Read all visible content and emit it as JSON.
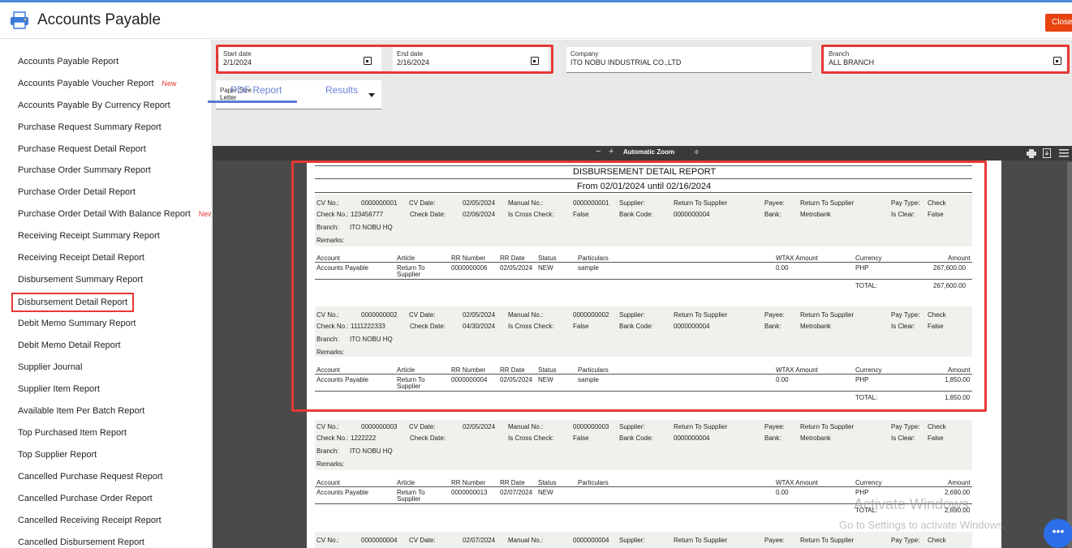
{
  "header": {
    "title": "Accounts Payable",
    "close_label": "Close"
  },
  "sidebar": {
    "items": [
      {
        "label": "Accounts Payable Report",
        "badge": ""
      },
      {
        "label": "Accounts Payable Voucher Report",
        "badge": "New"
      },
      {
        "label": "Accounts Payable By Currency Report",
        "badge": ""
      },
      {
        "label": "Purchase Request Summary Report",
        "badge": ""
      },
      {
        "label": "Purchase Request Detail Report",
        "badge": ""
      },
      {
        "label": "Purchase Order Summary Report",
        "badge": ""
      },
      {
        "label": "Purchase Order Detail Report",
        "badge": ""
      },
      {
        "label": "Purchase Order Detail With Balance Report",
        "badge": "New"
      },
      {
        "label": "Receiving Receipt Summary Report",
        "badge": ""
      },
      {
        "label": "Receiving Receipt Detail Report",
        "badge": ""
      },
      {
        "label": "Disbursement Summary Report",
        "badge": ""
      },
      {
        "label": "Disbursement Detail Report",
        "badge": ""
      },
      {
        "label": "Debit Memo Summary Report",
        "badge": ""
      },
      {
        "label": "Debit Memo Detail Report",
        "badge": ""
      },
      {
        "label": "Supplier Journal",
        "badge": ""
      },
      {
        "label": "Supplier Item Report",
        "badge": ""
      },
      {
        "label": "Available Item Per Batch Report",
        "badge": ""
      },
      {
        "label": "Top Purchased Item Report",
        "badge": ""
      },
      {
        "label": "Top Supplier Report",
        "badge": ""
      },
      {
        "label": "Cancelled Purchase Request Report",
        "badge": ""
      },
      {
        "label": "Cancelled Purchase Order Report",
        "badge": ""
      },
      {
        "label": "Cancelled Receiving Receipt Report",
        "badge": ""
      },
      {
        "label": "Cancelled Disbursement Report",
        "badge": ""
      }
    ]
  },
  "filters": {
    "start_date": {
      "label": "Start date",
      "value": "2/1/2024"
    },
    "end_date": {
      "label": "End date",
      "value": "2/16/2024"
    },
    "company": {
      "label": "Company",
      "value": "ITO NOBU INDUSTRIAL CO.,LTD"
    },
    "branch": {
      "label": "Branch",
      "value": "ALL BRANCH"
    },
    "paper_size": {
      "label": "Paper Size",
      "value": "Letter"
    }
  },
  "tabs": [
    {
      "label": "PDF Report"
    },
    {
      "label": "Results"
    }
  ],
  "viewer": {
    "minus": "−",
    "plus": "+",
    "zoom": "Automatic Zoom",
    "zoom_caret": "≑"
  },
  "report": {
    "title": "DISBURSEMENT DETAIL REPORT",
    "subtitle": "From 02/01/2024 until 02/16/2024",
    "labels": {
      "cv_no": "CV No.:",
      "cv_date": "CV Date:",
      "manual_no": "Manual No.:",
      "supplier": "Supplier:",
      "payee": "Payee:",
      "pay_type": "Pay Type:",
      "check_no": "Check No.:",
      "check_date": "Check Date:",
      "cross": "Is Cross Check:",
      "bank_code": "Bank Code:",
      "bank": "Bank:",
      "is_clear": "Is Clear:",
      "branch": "Branch:",
      "remarks": "Remarks:",
      "account": "Account",
      "article": "Article",
      "rr_number": "RR Number",
      "rr_date": "RR Date",
      "status": "Status",
      "particulars": "Particulars",
      "wtax": "WTAX Amount",
      "currency": "Currency",
      "amount": "Amount",
      "total": "TOTAL:"
    },
    "vouchers": [
      {
        "cv_no": "0000000001",
        "cv_date": "02/05/2024",
        "manual_no": "0000000001",
        "supplier": "Return To Supplier",
        "payee": "Return To Supplier",
        "pay_type": "Check",
        "check_no": "123456777",
        "check_date": "02/06/2024",
        "cross": "False",
        "bank_code": "0000000004",
        "bank": "Metrobank",
        "is_clear": "False",
        "branch": "ITO NOBU HQ",
        "account": "Accounts Payable",
        "article1": "Return To",
        "article2": "Supplier",
        "rr_number": "0000000006",
        "rr_date": "02/05/2024",
        "status": "NEW",
        "particulars": "sample",
        "wtax": "0.00",
        "currency": "PHP",
        "amount": "267,600.00",
        "total": "267,600.00"
      },
      {
        "cv_no": "0000000002",
        "cv_date": "02/05/2024",
        "manual_no": "0000000002",
        "supplier": "Return To Supplier",
        "payee": "Return To Supplier",
        "pay_type": "Check",
        "check_no": "1111222333",
        "check_date": "04/30/2024",
        "cross": "False",
        "bank_code": "0000000004",
        "bank": "Metrobank",
        "is_clear": "False",
        "branch": "ITO NOBU HQ",
        "account": "Accounts Payable",
        "article1": "Return To",
        "article2": "Supplier",
        "rr_number": "0000000004",
        "rr_date": "02/05/2024",
        "status": "NEW",
        "particulars": "sample",
        "wtax": "0.00",
        "currency": "PHP",
        "amount": "1,850.00",
        "total": "1,850.00"
      },
      {
        "cv_no": "0000000003",
        "cv_date": "02/05/2024",
        "manual_no": "0000000003",
        "supplier": "Return To Supplier",
        "payee": "Return To Supplier",
        "pay_type": "Check",
        "check_no": "1222222",
        "check_date": "",
        "cross": "False",
        "bank_code": "0000000004",
        "bank": "Metrobank",
        "is_clear": "False",
        "branch": "ITO NOBU HQ",
        "account": "Accounts Payable",
        "article1": "Return To",
        "article2": "Supplier",
        "rr_number": "0000000013",
        "rr_date": "02/07/2024",
        "status": "NEW",
        "particulars": "",
        "wtax": "0.00",
        "currency": "PHP",
        "amount": "2,690.00",
        "total": "2,690.00"
      },
      {
        "cv_no": "0000000004",
        "cv_date": "02/07/2024",
        "manual_no": "0000000004",
        "supplier": "Return To Supplier",
        "payee": "Return To Supplier",
        "pay_type": "Check"
      }
    ]
  },
  "watermark": {
    "line1": "Activate Windows",
    "line2": "Go to Settings to activate Windows."
  },
  "fab": {
    "label": "•••"
  }
}
